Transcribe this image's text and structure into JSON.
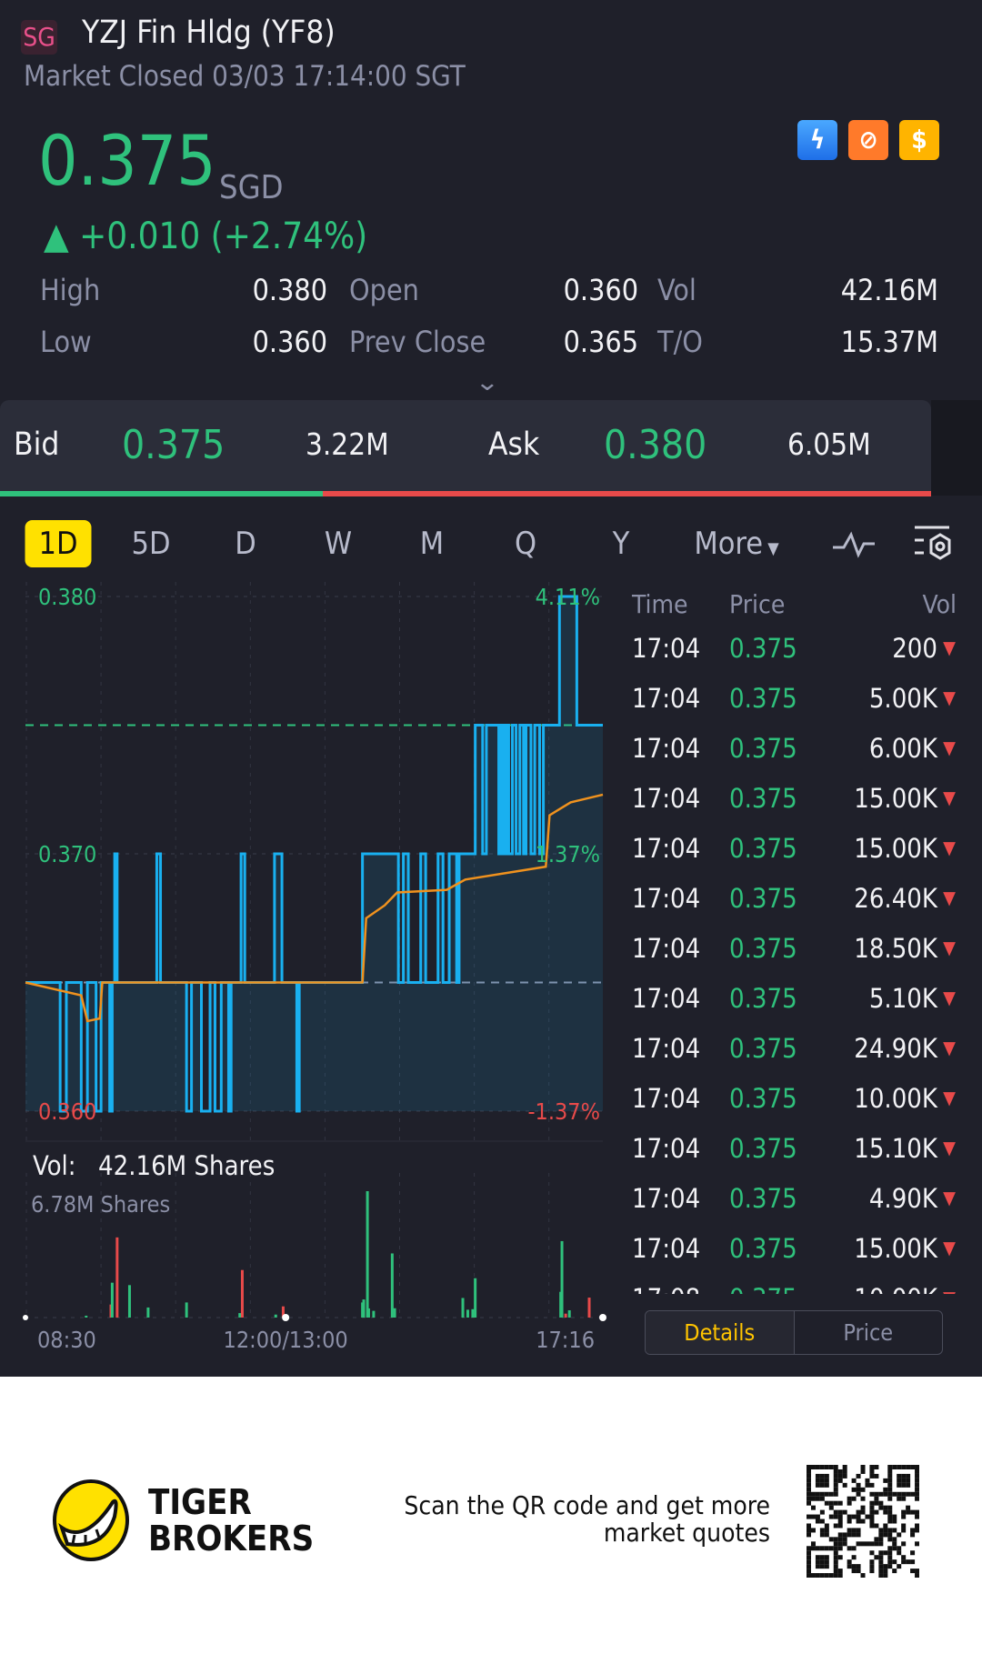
{
  "header": {
    "market_badge": "SG",
    "title": "YZJ Fin Hldg (YF8)",
    "status": "Market Closed 03/03 17:14:00 SGT"
  },
  "quote": {
    "price": "0.375",
    "currency": "SGD",
    "change": "+0.010 (+2.74%)",
    "stats": [
      {
        "label": "High",
        "value": "0.380"
      },
      {
        "label": "Open",
        "value": "0.360"
      },
      {
        "label": "Vol",
        "value": "42.16M"
      },
      {
        "label": "Low",
        "value": "0.360"
      },
      {
        "label": "Prev Close",
        "value": "0.365"
      },
      {
        "label": "T/O",
        "value": "15.37M"
      }
    ],
    "icons": [
      "level1-lightning-icon",
      "trade-swap-icon",
      "dollar-icon"
    ]
  },
  "bid_ask": {
    "bid_label": "Bid",
    "bid_price": "0.375",
    "bid_size": "3.22M",
    "ask_label": "Ask",
    "ask_price": "0.380",
    "ask_size": "6.05M",
    "bid_fraction": 0.347
  },
  "tabs": [
    "1D",
    "5D",
    "D",
    "W",
    "M",
    "Q",
    "Y",
    "More"
  ],
  "active_tab": "1D",
  "chart_data": [
    {
      "type": "line",
      "title": "Intraday price",
      "y_labels": {
        "high": "0.380",
        "mid": "0.370",
        "low": "0.360"
      },
      "pct_labels": {
        "high": "4.11%",
        "mid": "1.37%",
        "low": "-1.37%"
      },
      "ylim": [
        0.36,
        0.38
      ],
      "prev_close": 0.365,
      "last": 0.375,
      "x_unit": "session minutes from 08:30 (lunch break removed)",
      "x_range": [
        0,
        466
      ],
      "price": [
        [
          0,
          0.365
        ],
        [
          28,
          0.36
        ],
        [
          33,
          0.365
        ],
        [
          45,
          0.36
        ],
        [
          50,
          0.365
        ],
        [
          57,
          0.36
        ],
        [
          61,
          0.365
        ],
        [
          68,
          0.36
        ],
        [
          70,
          0.365
        ],
        [
          72,
          0.37
        ],
        [
          74,
          0.365
        ],
        [
          106,
          0.37
        ],
        [
          109,
          0.365
        ],
        [
          130,
          0.36
        ],
        [
          134,
          0.365
        ],
        [
          142,
          0.36
        ],
        [
          149,
          0.365
        ],
        [
          153,
          0.36
        ],
        [
          158,
          0.365
        ],
        [
          164,
          0.36
        ],
        [
          166,
          0.365
        ],
        [
          174,
          0.37
        ],
        [
          177,
          0.365
        ],
        [
          201,
          0.37
        ],
        [
          207,
          0.365
        ],
        [
          219,
          0.36
        ],
        [
          221,
          0.365
        ],
        [
          272,
          0.37
        ],
        [
          301,
          0.365
        ],
        [
          305,
          0.37
        ],
        [
          309,
          0.365
        ],
        [
          319,
          0.37
        ],
        [
          323,
          0.365
        ],
        [
          333,
          0.37
        ],
        [
          337,
          0.365
        ],
        [
          342,
          0.37
        ],
        [
          348,
          0.365
        ],
        [
          350,
          0.37
        ],
        [
          363,
          0.375
        ],
        [
          369,
          0.37
        ],
        [
          372,
          0.375
        ],
        [
          382,
          0.37
        ],
        [
          384,
          0.375
        ],
        [
          386,
          0.37
        ],
        [
          388,
          0.375
        ],
        [
          390,
          0.37
        ],
        [
          393,
          0.375
        ],
        [
          396,
          0.37
        ],
        [
          399,
          0.375
        ],
        [
          402,
          0.37
        ],
        [
          404,
          0.375
        ],
        [
          408,
          0.37
        ],
        [
          411,
          0.375
        ],
        [
          415,
          0.37
        ],
        [
          418,
          0.375
        ],
        [
          431,
          0.38
        ],
        [
          436,
          0.38
        ],
        [
          445,
          0.375
        ],
        [
          466,
          0.375
        ]
      ],
      "average": [
        [
          0,
          0.365
        ],
        [
          45,
          0.3645
        ],
        [
          50,
          0.3635
        ],
        [
          60,
          0.3636
        ],
        [
          62,
          0.365
        ],
        [
          272,
          0.365
        ],
        [
          275,
          0.3675
        ],
        [
          290,
          0.368
        ],
        [
          300,
          0.3685
        ],
        [
          340,
          0.3686
        ],
        [
          355,
          0.369
        ],
        [
          420,
          0.3695
        ],
        [
          423,
          0.3715
        ],
        [
          440,
          0.372
        ],
        [
          466,
          0.3723
        ]
      ]
    },
    {
      "type": "bar",
      "title": "Volume",
      "label": "Vol:",
      "total": "42.16M Shares",
      "max_label": "6.78M Shares",
      "ymax": 6.78,
      "x_labels": [
        "08:30",
        "12:00/13:00",
        "17:16"
      ],
      "bars": [
        [
          49,
          0.1,
          "up"
        ],
        [
          69,
          0.7,
          "down"
        ],
        [
          70,
          1.87,
          "up"
        ],
        [
          74,
          4.3,
          "down"
        ],
        [
          84,
          1.74,
          "up"
        ],
        [
          99,
          0.54,
          "up"
        ],
        [
          130,
          0.81,
          "up"
        ],
        [
          173,
          0.24,
          "up"
        ],
        [
          175,
          2.55,
          "down"
        ],
        [
          202,
          0.16,
          "up"
        ],
        [
          208,
          0.6,
          "down"
        ],
        [
          272,
          0.81,
          "up"
        ],
        [
          273,
          0.97,
          "up"
        ],
        [
          276,
          6.78,
          "up"
        ],
        [
          277,
          0.49,
          "up"
        ],
        [
          281,
          0.36,
          "up"
        ],
        [
          296,
          3.44,
          "up"
        ],
        [
          298,
          0.5,
          "up"
        ],
        [
          353,
          1.05,
          "up"
        ],
        [
          357,
          0.42,
          "up"
        ],
        [
          361,
          0.45,
          "up"
        ],
        [
          363,
          2.11,
          "up"
        ],
        [
          432,
          1.38,
          "up"
        ],
        [
          433,
          4.1,
          "up"
        ],
        [
          436,
          0.21,
          "down"
        ],
        [
          439,
          0.39,
          "up"
        ],
        [
          455,
          1.07,
          "down"
        ]
      ]
    }
  ],
  "ticks": {
    "headers": {
      "time": "Time",
      "price": "Price",
      "vol": "Vol"
    },
    "rows": [
      [
        "17:04",
        "0.375",
        "200"
      ],
      [
        "17:04",
        "0.375",
        "5.00K"
      ],
      [
        "17:04",
        "0.375",
        "6.00K"
      ],
      [
        "17:04",
        "0.375",
        "15.00K"
      ],
      [
        "17:04",
        "0.375",
        "15.00K"
      ],
      [
        "17:04",
        "0.375",
        "26.40K"
      ],
      [
        "17:04",
        "0.375",
        "18.50K"
      ],
      [
        "17:04",
        "0.375",
        "5.10K"
      ],
      [
        "17:04",
        "0.375",
        "24.90K"
      ],
      [
        "17:04",
        "0.375",
        "10.00K"
      ],
      [
        "17:04",
        "0.375",
        "15.10K"
      ],
      [
        "17:04",
        "0.375",
        "4.90K"
      ],
      [
        "17:04",
        "0.375",
        "15.00K"
      ],
      [
        "17:08",
        "0.375",
        "10.00K"
      ]
    ],
    "details_label": "Details",
    "price_label": "Price"
  },
  "footer": {
    "brand_line1": "TIGER",
    "brand_line2": "BROKERS",
    "scan_line1": "Scan the QR code and get more",
    "scan_line2": "market quotes"
  },
  "colors": {
    "up": "#2fc17c",
    "down": "#e84a4a",
    "line": "#19b0f0",
    "avg": "#f0921e",
    "accent": "#ffe100"
  }
}
